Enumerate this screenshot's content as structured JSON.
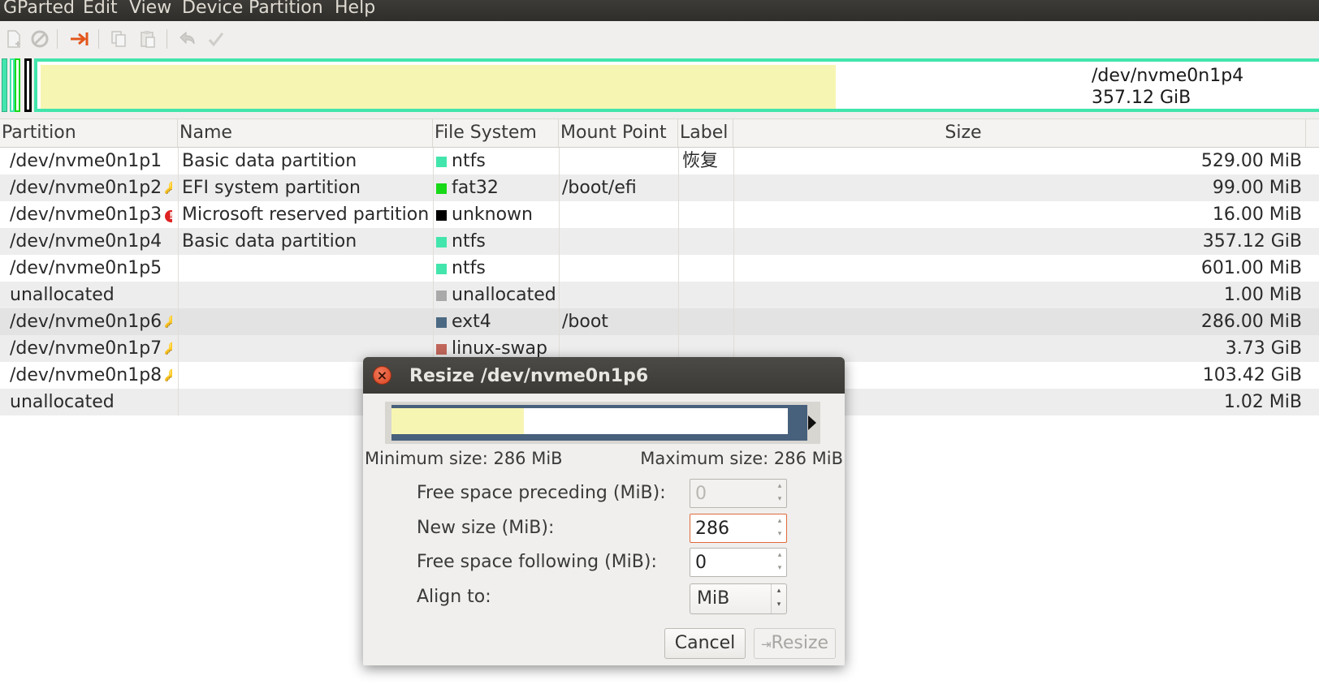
{
  "menubar": {
    "items": [
      "GParted",
      "Edit",
      "View",
      "Device",
      "Partition",
      "Help"
    ]
  },
  "toolbar": {
    "buttons": [
      "new-icon",
      "delete-icon",
      "resize-move-icon",
      "copy-icon",
      "paste-icon",
      "undo-icon",
      "apply-icon"
    ]
  },
  "diskmap": {
    "selected_path": "/dev/nvme0n1p4",
    "selected_size": "357.12 GiB"
  },
  "table": {
    "columns": [
      "Partition",
      "Name",
      "File System",
      "Mount Point",
      "Label",
      "Size"
    ],
    "rows": [
      {
        "partition": "/dev/nvme0n1p1",
        "name": "Basic data partition",
        "fs": "ntfs",
        "fs_color": "#42e5ac",
        "mount": "",
        "label": "恢复",
        "size": "529.00 MiB",
        "icon": ""
      },
      {
        "partition": "/dev/nvme0n1p2",
        "name": "EFI system partition",
        "fs": "fat32",
        "fs_color": "#18d918",
        "mount": "/boot/efi",
        "label": "",
        "size": "99.00 MiB",
        "icon": "key"
      },
      {
        "partition": "/dev/nvme0n1p3",
        "name": "Microsoft reserved partition",
        "fs": "unknown",
        "fs_color": "#000000",
        "mount": "",
        "label": "",
        "size": "16.00 MiB",
        "icon": "warn"
      },
      {
        "partition": "/dev/nvme0n1p4",
        "name": "Basic data partition",
        "fs": "ntfs",
        "fs_color": "#42e5ac",
        "mount": "",
        "label": "",
        "size": "357.12 GiB",
        "icon": ""
      },
      {
        "partition": "/dev/nvme0n1p5",
        "name": "",
        "fs": "ntfs",
        "fs_color": "#42e5ac",
        "mount": "",
        "label": "",
        "size": "601.00 MiB",
        "icon": ""
      },
      {
        "partition": "unallocated",
        "name": "",
        "fs": "unallocated",
        "fs_color": "#a9a9a9",
        "mount": "",
        "label": "",
        "size": "1.00 MiB",
        "icon": ""
      },
      {
        "partition": "/dev/nvme0n1p6",
        "name": "",
        "fs": "ext4",
        "fs_color": "#4b6983",
        "mount": "/boot",
        "label": "",
        "size": "286.00 MiB",
        "icon": "key"
      },
      {
        "partition": "/dev/nvme0n1p7",
        "name": "",
        "fs": "linux-swap",
        "fs_color": "#c1665a",
        "mount": "",
        "label": "",
        "size": "3.73 GiB",
        "icon": "key"
      },
      {
        "partition": "/dev/nvme0n1p8",
        "name": "",
        "fs": "",
        "fs_color": "",
        "mount": "",
        "label": "",
        "size": "103.42 GiB",
        "icon": "key"
      },
      {
        "partition": "unallocated",
        "name": "",
        "fs": "",
        "fs_color": "",
        "mount": "",
        "label": "",
        "size": "1.02 MiB",
        "icon": ""
      }
    ]
  },
  "dialog": {
    "title": "Resize /dev/nvme0n1p6",
    "min_size": "Minimum size: 286 MiB",
    "max_size": "Maximum size: 286 MiB",
    "fields": {
      "preceding_label": "Free space preceding (MiB):",
      "preceding_value": "0",
      "new_size_label": "New size (MiB):",
      "new_size_value": "286",
      "following_label": "Free space following (MiB):",
      "following_value": "0",
      "align_label": "Align to:",
      "align_value": "MiB"
    },
    "cancel_label": "Cancel",
    "resize_label": "Resize"
  },
  "colors": {
    "ntfs": "#42e5ac",
    "fat32": "#18d918",
    "ext4": "#4b6983",
    "used": "#f7f5b2",
    "close": "#d94420"
  }
}
